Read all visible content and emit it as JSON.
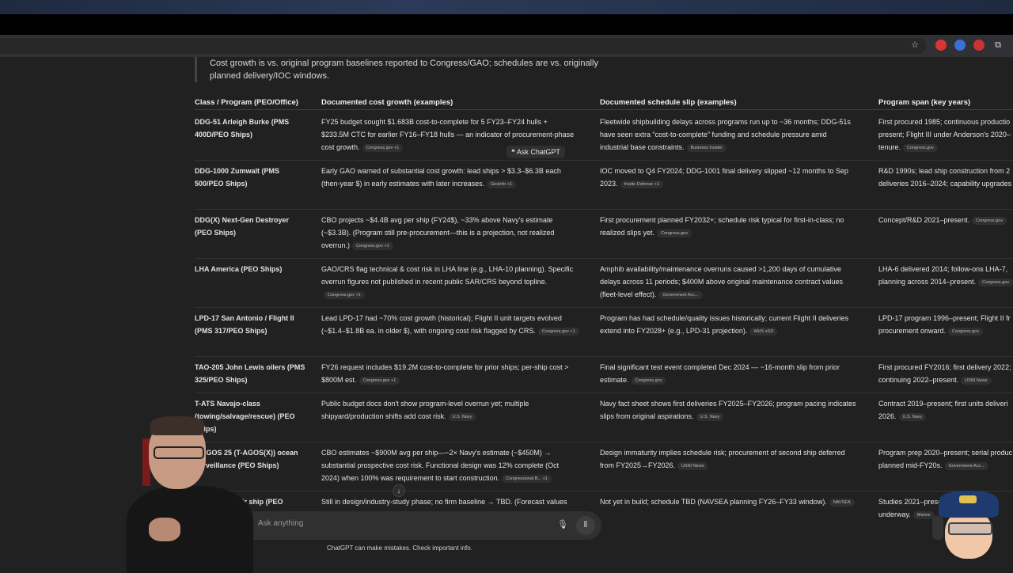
{
  "note": {
    "line1": "Cost growth is vs. original program baselines reported to Congress/GAO; schedules are vs. originally",
    "line2": "planned delivery/IOC windows."
  },
  "table": {
    "headers": [
      "Class / Program (PEO/Office)",
      "Documented cost growth (examples)",
      "Documented schedule slip (examples)",
      "Program span (key years)"
    ],
    "rows": [
      {
        "program": [
          "DDG-51 Arleigh Burke (PMS",
          "400D/PEO Ships)"
        ],
        "cost": [
          "FY25 budget sought $1.683B cost-to-complete for 5 FY23–FY24 hulls +",
          "$233.5M CTC for earlier FY16–FY18 hulls — an indicator of procurement-phase",
          "cost growth."
        ],
        "cost_cite": "Congress.gov +1",
        "schedule": [
          "Fleetwide shipbuilding delays across programs run up to ~36 months; DDG-51s",
          "have seen extra “cost-to-complete” funding and schedule pressure amid",
          "industrial base constraints."
        ],
        "schedule_cite": "Business Insider",
        "span": [
          "First procured 1985; continuous productio",
          "present; Flight III under Anderson's 2020–",
          "tenure."
        ],
        "span_cite": "Congress.gov"
      },
      {
        "program": [
          "DDG-1000 Zumwalt (PMS",
          "500/PEO Ships)"
        ],
        "cost": [
          "Early GAO warned of substantial cost growth: lead ships > $3.3–$6.3B each",
          "(then-year $) in early estimates with later increases."
        ],
        "cost_cite": "GovInfo +1",
        "schedule": [
          "IOC moved to Q4 FY2024; DDG-1001 final delivery slipped ~12 months to Sep",
          "2023."
        ],
        "schedule_cite": "Inside Defense +1",
        "span": [
          "R&D 1990s; lead ship construction from 2",
          "deliveries 2016–2024; capability upgrades"
        ],
        "span_cite": "USNI News"
      },
      {
        "program": [
          "DDG(X) Next-Gen Destroyer",
          "(PEO Ships)"
        ],
        "cost": [
          "CBO projects ~$4.4B avg per ship (FY24$), ~33% above Navy's estimate",
          "(~$3.3B). (Program still pre-procurement—this is a projection, not realized",
          "overrun.)"
        ],
        "cost_cite": "Congress.gov +1",
        "schedule": [
          "First procurement planned FY2032+; schedule risk typical for first-in-class; no",
          "realized slips yet."
        ],
        "schedule_cite": "Congress.gov",
        "span": [
          "Concept/R&D 2021–present."
        ],
        "span_cite": "Congress.gov"
      },
      {
        "program": [
          "LHA America (PEO Ships)"
        ],
        "cost": [
          "GAO/CRS flag technical & cost risk in LHA line (e.g., LHA-10 planning). Specific",
          "overrun figures not published in recent public SAR/CRS beyond topline."
        ],
        "cost_cite": "Congress.gov +1",
        "schedule": [
          "Amphib availability/maintenance overruns caused >1,200 days of cumulative",
          "delays across 11 periods; $400M above original maintenance contract values",
          "(fleet-level effect)."
        ],
        "schedule_cite": "Government Acc...",
        "span": [
          "LHA-6 delivered 2014; follow-ons LHA-7,",
          "planning across 2014–present."
        ],
        "span_cite": "Congress.gov"
      },
      {
        "program": [
          "LPD-17 San Antonio / Flight II",
          "(PMS 317/PEO Ships)"
        ],
        "cost": [
          "Lead LPD-17 had ~70% cost growth (historical); Flight II unit targets evolved",
          "(~$1.4–$1.8B ea. in older $), with ongoing cost risk flagged by CRS."
        ],
        "cost_cite": "Congress.gov +1",
        "schedule": [
          "Program has had schedule/quality issues historically; current Flight II deliveries",
          "extend into FY2028+ (e.g., LPD-31 projection)."
        ],
        "schedule_cite": "WHS eSD",
        "span": [
          "LPD-17 program 1996–present; Flight II fr",
          "procurement onward."
        ],
        "span_cite": "Congress.gov"
      },
      {
        "program": [
          "TAO-205 John Lewis oilers (PMS",
          "325/PEO Ships)"
        ],
        "cost": [
          "FY26 request includes $19.2M cost-to-complete for prior ships; per-ship cost >",
          "$800M est."
        ],
        "cost_cite": "Congress.gov +1",
        "schedule": [
          "Final significant test event completed Dec 2024 — ~16-month slip from prior",
          "estimate."
        ],
        "schedule_cite": "Congress.gov",
        "span": [
          "First procured FY2016; first delivery 2022;",
          "continuing 2022–present."
        ],
        "span_cite": "USNI News"
      },
      {
        "program": [
          "T-ATS Navajo-class",
          "(towing/salvage/rescue) (PEO",
          "Ships)"
        ],
        "cost": [
          "Public budget docs don't show program-level overrun yet; multiple",
          "shipyard/production shifts add cost risk."
        ],
        "cost_cite": "U.S. Navy",
        "schedule": [
          "Navy fact sheet shows first deliveries FY2025–FY2026; program pacing indicates",
          "slips from original aspirations."
        ],
        "schedule_cite": "U.S. Navy",
        "span": [
          "Contract 2019–present; first units deliveri",
          "2026."
        ],
        "span_cite": "U.S. Navy"
      },
      {
        "program": [
          "T-AGOS 25 (T-AGOS(X)) ocean",
          "surveillance (PEO Ships)"
        ],
        "cost": [
          "CBO estimates ~$900M avg per ship—~2× Navy's estimate (~$450M) →",
          "substantial prospective cost risk. Functional design was 12% complete (Oct",
          "2024) when 100% was requirement to start construction."
        ],
        "cost_cite": "Congressional B... +1",
        "schedule": [
          "Design immaturity implies schedule risk; procurement of second ship deferred",
          "from FY2025→FY2026."
        ],
        "schedule_cite": "USNI News",
        "span": [
          "Program prep 2020–present; serial produc",
          "planned mid-FY20s."
        ],
        "span_cite": "Government Acc..."
      },
      {
        "program": [
          "Next-gen repair ship (PEO"
        ],
        "cost": [
          "Still in design/industry-study phase; no firm baseline → TBD. (Forecast values"
        ],
        "cost_cite": "",
        "schedule": [
          "Not yet in build; schedule TBD (NAVSEA planning FY26–FY33 window)."
        ],
        "schedule_cite": "NAVSEA",
        "span": [
          "Studies 2021–prese",
          "underway."
        ],
        "span_cite": "Marine"
      }
    ]
  },
  "tooltip": "Ask ChatGPT",
  "composer": {
    "placeholder": "Ask anything"
  },
  "disclaimer": "ChatGPT can make mistakes. Check important info.",
  "colors": {
    "background": "#212121",
    "text": "#ececec",
    "muted": "#9a9a9a"
  }
}
